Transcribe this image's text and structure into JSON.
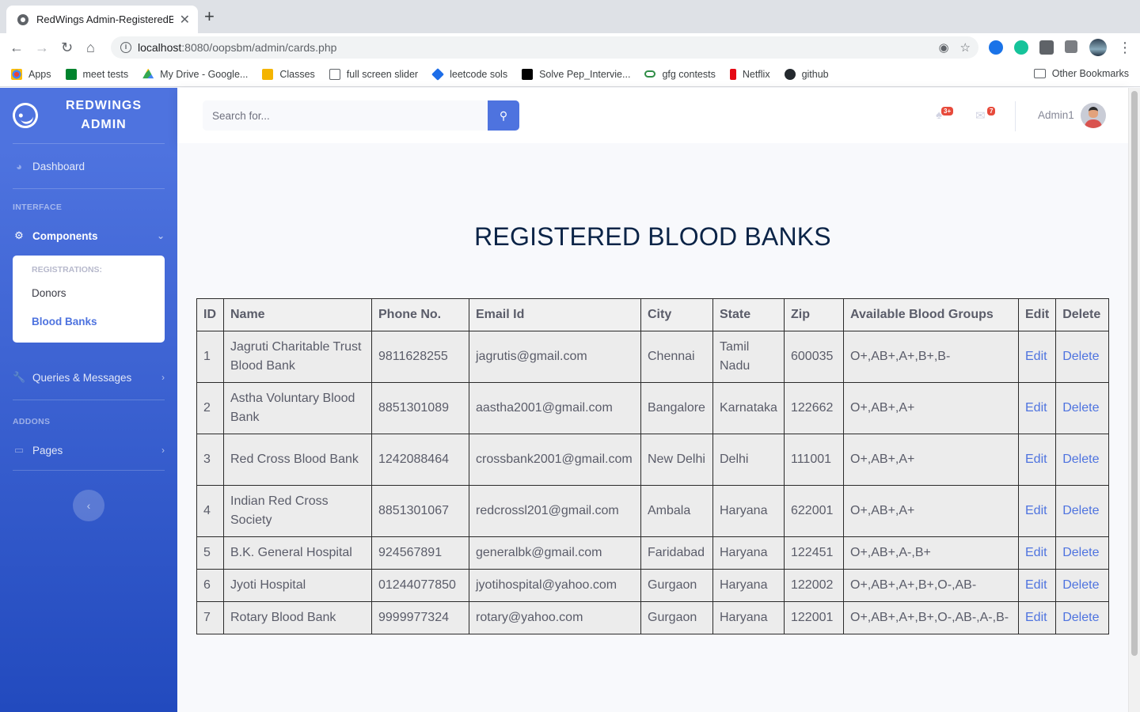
{
  "browser": {
    "tab_title": "RedWings Admin-RegisteredBl",
    "tab_close": "✕",
    "new_tab": "+",
    "url_host": "localhost",
    "url_path": ":8080/oopsbm/admin/cards.php",
    "bookmarks": [
      "Apps",
      "meet tests",
      "My Drive - Google...",
      "Classes",
      "full screen slider",
      "leetcode sols",
      "Solve Pep_Intervie...",
      "gfg contests",
      "Netflix",
      "github"
    ],
    "other_bookmarks": "Other Bookmarks"
  },
  "sidebar": {
    "brand_line1": "REDWINGS",
    "brand_line2": "ADMIN",
    "dashboard": "Dashboard",
    "heading_interface": "INTERFACE",
    "components": "Components",
    "collapse_heading": "REGISTRATIONS:",
    "collapse_items": [
      "Donors",
      "Blood Banks"
    ],
    "queries": "Queries & Messages",
    "heading_addons": "ADDONS",
    "pages": "Pages"
  },
  "topbar": {
    "search_placeholder": "Search for...",
    "alerts_badge": "3+",
    "messages_badge": "7",
    "user_name": "Admin1"
  },
  "main": {
    "title": "REGISTERED BLOOD BANKS",
    "columns": [
      "ID",
      "Name",
      "Phone No.",
      "Email Id",
      "City",
      "State",
      "Zip",
      "Available Blood Groups",
      "Edit",
      "Delete"
    ],
    "rows": [
      [
        "1",
        "Jagruti Charitable Trust Blood Bank",
        "9811628255",
        "jagrutis@gmail.com",
        "Chennai",
        "Tamil Nadu",
        "600035",
        "O+,AB+,A+,B+,B-",
        "Edit",
        "Delete"
      ],
      [
        "2",
        "Astha Voluntary Blood Bank",
        "8851301089",
        "aastha2001@gmail.com",
        "Bangalore",
        "Karnataka",
        "122662",
        "O+,AB+,A+",
        "Edit",
        "Delete"
      ],
      [
        "3",
        "Red Cross Blood Bank",
        "1242088464",
        "crossbank2001@gmail.com",
        "New Delhi",
        "Delhi",
        "111001",
        "O+,AB+,A+",
        "Edit",
        "Delete"
      ],
      [
        "4",
        "Indian Red Cross Society",
        "8851301067",
        "redcrossl201@gmail.com",
        "Ambala",
        "Haryana",
        "622001",
        "O+,AB+,A+",
        "Edit",
        "Delete"
      ],
      [
        "5",
        "B.K. General Hospital",
        "924567891",
        "generalbk@gmail.com",
        "Faridabad",
        "Haryana",
        "122451",
        "O+,AB+,A-,B+",
        "Edit",
        "Delete"
      ],
      [
        "6",
        "Jyoti Hospital",
        "01244077850",
        "jyotihospital@yahoo.com",
        "Gurgaon",
        "Haryana",
        "122002",
        "O+,AB+,A+,B+,O-,AB-",
        "Edit",
        "Delete"
      ],
      [
        "7",
        "Rotary Blood Bank",
        "9999977324",
        "rotary@yahoo.com",
        "Gurgaon",
        "Haryana",
        "122001",
        "O+,AB+,A+,B+,O-,AB-,A-,B-",
        "Edit",
        "Delete"
      ]
    ]
  },
  "colors": {
    "primary": "#4e73df",
    "sidebar_bottom": "#224abe",
    "title": "#0b2447",
    "badge": "#e74a3b"
  }
}
